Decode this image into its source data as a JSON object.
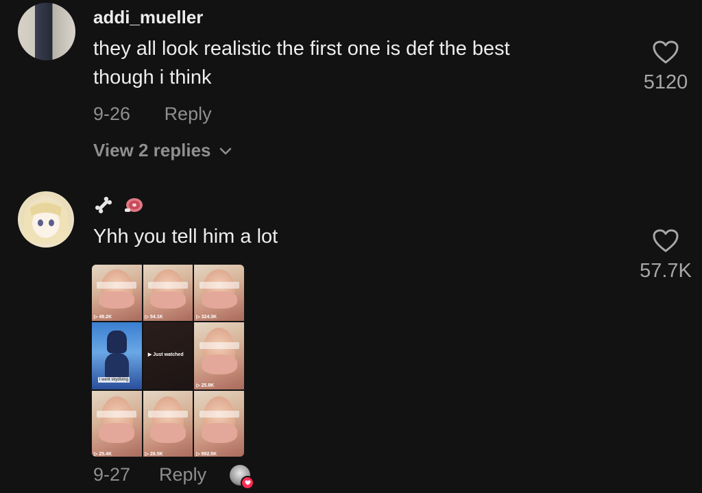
{
  "comments": [
    {
      "username": "addi_mueller",
      "text_line1": "they all look realistic the first one is def the best",
      "text_line2": "though i think",
      "date": "9-26",
      "reply_label": "Reply",
      "view_replies": "View 2 replies",
      "likes": "5120"
    },
    {
      "username_icons": [
        "bone-icon",
        "meat-icon"
      ],
      "text": "Yhh you tell him a lot",
      "date": "9-27",
      "reply_label": "Reply",
      "likes": "57.7K",
      "liked_by_creator": true,
      "image_grid": {
        "tiles": [
          {
            "views": "49.2K"
          },
          {
            "views": "54.1K"
          },
          {
            "views": "324.3K"
          },
          {
            "caption": "I went skydiving"
          },
          {
            "overlay": "Just watched"
          },
          {
            "views": "25.8K"
          },
          {
            "views": "25.4K"
          },
          {
            "views": "26.5K"
          },
          {
            "views": "992.5K"
          }
        ]
      }
    }
  ],
  "colors": {
    "background": "#121212",
    "primary_text": "#ededed",
    "secondary_text": "#8f8f8f",
    "accent_heart": "#fe2c55"
  }
}
